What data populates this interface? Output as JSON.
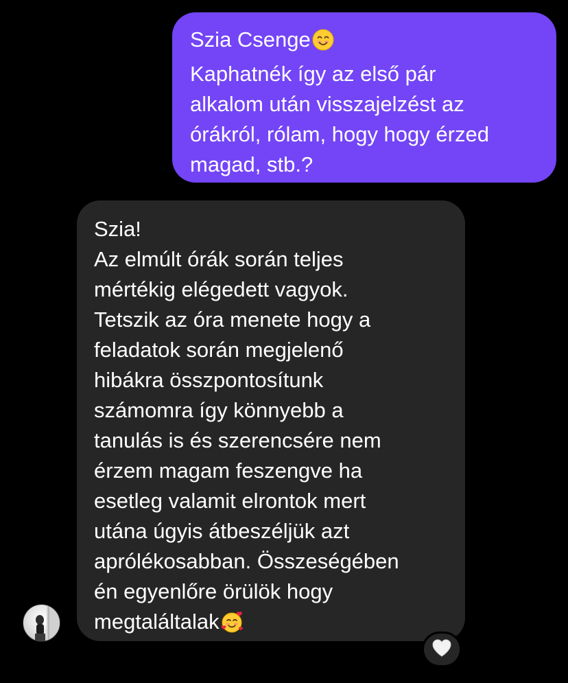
{
  "conversation": {
    "sent_message": {
      "text": "Szia Csenge\nKaphatnék így az első pár\nalkalom után visszajelzést az\nórákról, rólam, hogy hogy érzed\nmagad, stb.?",
      "emoji_after_first_line": "smiling-face-icon"
    },
    "received_message": {
      "text": "Szia!\nAz elmúlt órák során teljes\nmértékig elégedett vagyok.\nTetszik az óra menete hogy a\nfeladatok során megjelenő\nhibákra összpontosítunk\nszámomra így könnyebb a\ntanulás is és szerencsére nem\nérzem magam feszengve ha\nesetleg valamit elrontok mert\nutána úgyis átbeszéljük azt\naprólékosabban. Összeségében\nén egyenlőre örülök hogy\nmegtaláltalak",
      "emoji_at_end": "smiling-face-with-hearts-icon",
      "reaction": "white-heart-icon"
    }
  },
  "colors": {
    "background": "#000000",
    "sent_bubble": "#7345f6",
    "received_bubble": "#262626",
    "text": "#ffffff"
  }
}
